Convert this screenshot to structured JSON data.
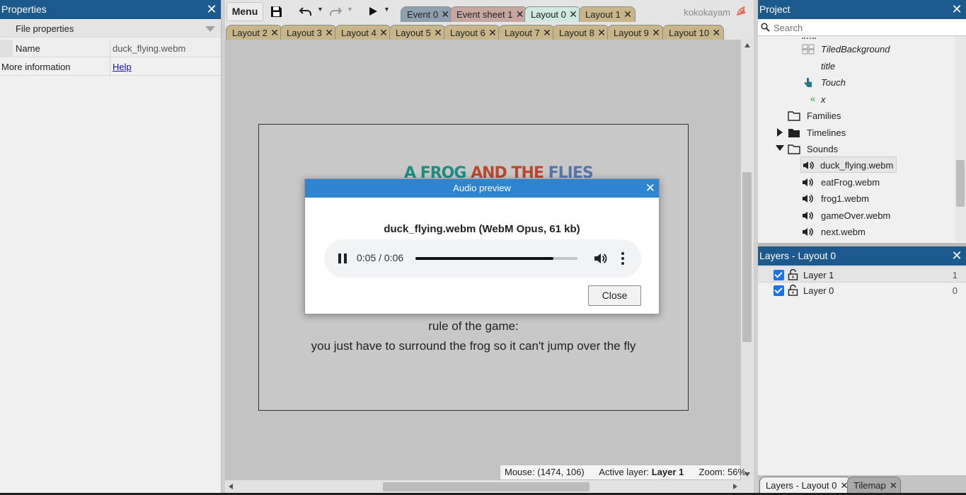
{
  "properties": {
    "title": "Properties",
    "category": "File properties",
    "name_label": "Name",
    "name_value": "duck_flying.webm",
    "more_info_label": "More information",
    "help_link": "Help"
  },
  "toolbar": {
    "menu_label": "Menu",
    "user": "kokokayam",
    "tabs_row1": [
      "Event 0",
      "Event sheet 1",
      "Layout 0",
      "Layout 1"
    ],
    "tabs_row2": [
      "Layout 2",
      "Layout 3",
      "Layout 4",
      "Layout 5",
      "Layout 6",
      "Layout 7",
      "Layout 8",
      "Layout 9",
      "Layout 10"
    ]
  },
  "canvas": {
    "game_title_words": [
      "A",
      "FROG",
      "AND",
      "THE",
      "FLIES"
    ],
    "rule_line1": "rule of the game:",
    "rule_line2": "you just have to surround the frog so it can't jump over the fly"
  },
  "status": {
    "mouse_label": "Mouse:",
    "mouse_value": "(1474, 106)",
    "active_layer_label": "Active layer:",
    "active_layer_value": "Layer 1",
    "zoom_label": "Zoom:",
    "zoom_value": "56%"
  },
  "dialog": {
    "title": "Audio preview",
    "file_info": "duck_flying.webm (WebM Opus, 61 kb)",
    "time": "0:05 / 0:06",
    "progress_fraction": 0.85,
    "close_label": "Close"
  },
  "project": {
    "title": "Project",
    "search_placeholder": "Search",
    "items": {
      "tiled_background": "TiledBackground",
      "title": "title",
      "touch": "Touch",
      "x": "x",
      "families": "Families",
      "timelines": "Timelines",
      "sounds": "Sounds",
      "duck_flying": "duck_flying.webm",
      "eat_frog": "eatFrog.webm",
      "frog1": "frog1.webm",
      "game_over": "gameOver.webm",
      "next": "next.webm"
    }
  },
  "layers": {
    "title": "Layers - Layout 0",
    "rows": [
      {
        "name": "Layer 1",
        "index": "1"
      },
      {
        "name": "Layer 0",
        "index": "0"
      }
    ]
  },
  "bottom_tabs": [
    "Layers - Layout 0",
    "Tilemap"
  ],
  "colors": {
    "panel_title": "#1c5a8e",
    "dialog_title": "#2f84d0",
    "checkbox": "#1a73e8",
    "tab_layout": "#c8b58a",
    "tab_event": "#8fa0b0",
    "tab_sheet": "#c6a7a0",
    "tab_active": "#cfe9e0"
  }
}
